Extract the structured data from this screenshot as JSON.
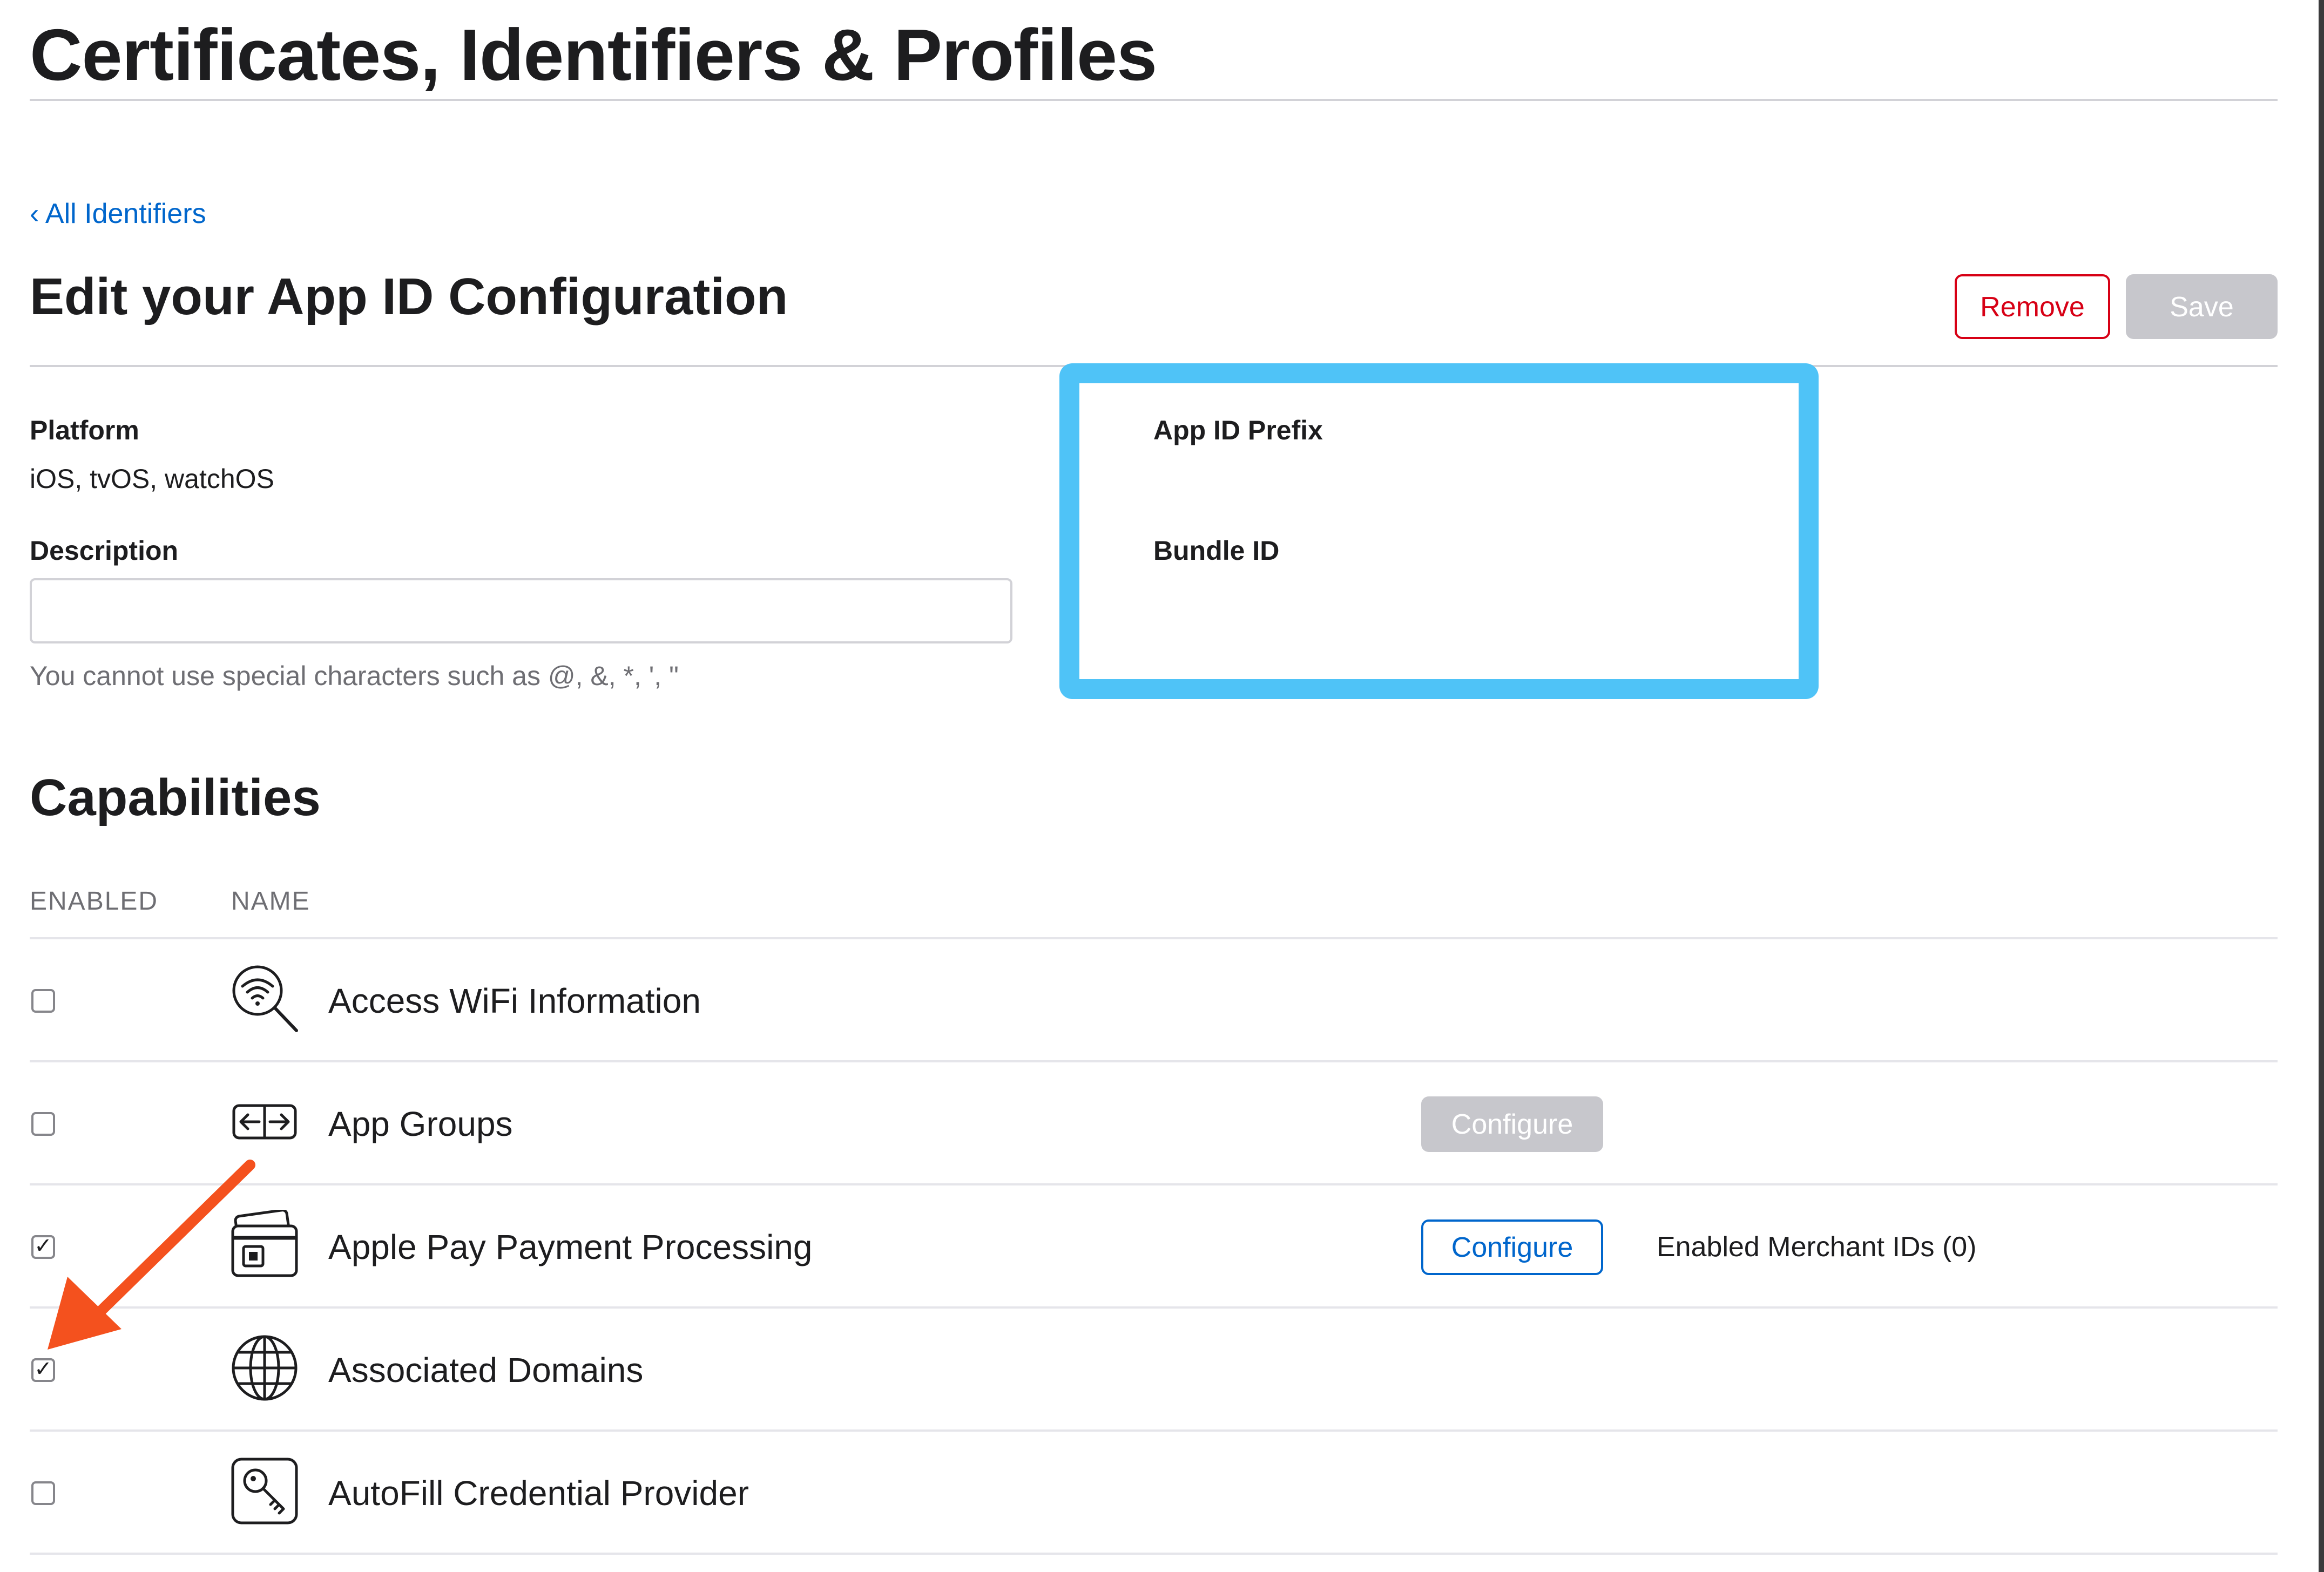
{
  "header": {
    "title": "Certificates, Identifiers & Profiles"
  },
  "nav": {
    "back_link": "‹ All Identifiers"
  },
  "form": {
    "title": "Edit your App ID Configuration",
    "remove_label": "Remove",
    "save_label": "Save",
    "platform_label": "Platform",
    "platform_value": "iOS, tvOS, watchOS",
    "description_label": "Description",
    "description_value": "",
    "description_hint": "You cannot use special characters such as @, &, *, ', \"",
    "app_id_prefix_label": "App ID Prefix",
    "bundle_id_label": "Bundle ID"
  },
  "capabilities": {
    "title": "Capabilities",
    "columns": {
      "enabled": "ENABLED",
      "name": "NAME"
    },
    "rows": [
      {
        "name": "Access WiFi Information",
        "enabled": false,
        "icon": "wifi-search-icon"
      },
      {
        "name": "App Groups",
        "enabled": false,
        "icon": "app-groups-icon",
        "configure": "Configure",
        "configure_enabled": false
      },
      {
        "name": "Apple Pay Payment Processing",
        "enabled": true,
        "icon": "apple-pay-card-icon",
        "configure": "Configure",
        "configure_enabled": true,
        "detail": "Enabled Merchant IDs (0)"
      },
      {
        "name": "Associated Domains",
        "enabled": true,
        "icon": "globe-icon"
      },
      {
        "name": "AutoFill Credential Provider",
        "enabled": false,
        "icon": "key-icon"
      }
    ]
  },
  "colors": {
    "link": "#0066cc",
    "remove": "#d70015",
    "disabled_button": "#c7c7cc",
    "highlight_box": "#4fc3f7",
    "annotation_arrow": "#f4511e"
  },
  "check_glyph": "✓"
}
